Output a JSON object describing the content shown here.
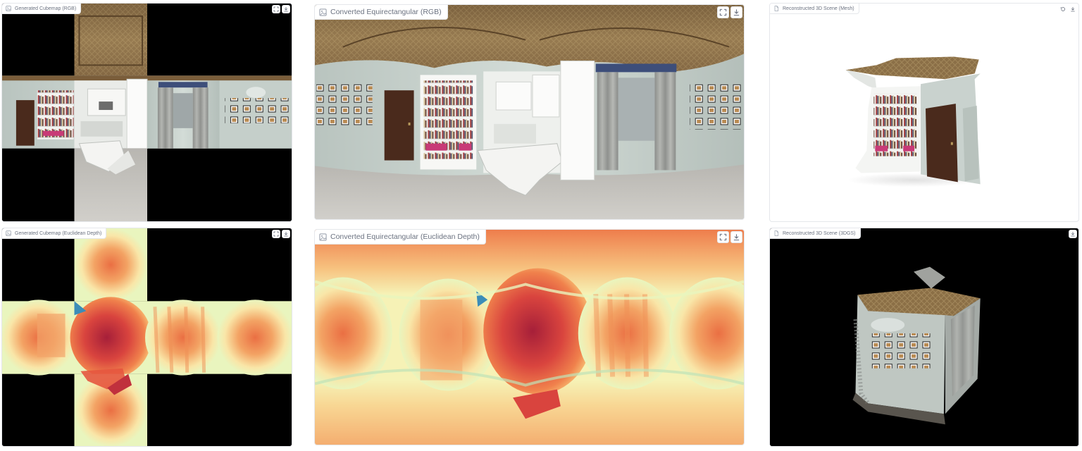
{
  "panels": {
    "cubemap_rgb": {
      "label": "Generated Cubemap (RGB)",
      "actions": [
        "fullscreen-icon",
        "download-icon"
      ]
    },
    "equirect_rgb": {
      "label": "Converted Equirectangular (RGB)",
      "actions": [
        "fullscreen-icon",
        "download-icon"
      ]
    },
    "mesh": {
      "label": "Reconstructed 3D Scene (Mesh)",
      "actions": [
        "reset-view-icon",
        "download-icon"
      ]
    },
    "cubemap_depth": {
      "label": "Generated Cubemap (Euclidean Depth)",
      "actions": [
        "fullscreen-icon",
        "download-icon"
      ]
    },
    "equirect_depth": {
      "label": "Converted Equirectangular (Euclidean Depth)",
      "actions": [
        "fullscreen-icon",
        "download-icon"
      ]
    },
    "gs3d": {
      "label": "Reconstructed 3D Scene (3DGS)",
      "actions": [
        "download-icon"
      ]
    }
  },
  "colors": {
    "wall": "#c9d3ce",
    "ceiling": "#8a6d45",
    "floor": "#c4c2bd",
    "door": "#4a2a1c",
    "depth_near": "#b2283c",
    "depth_mid": "#f08a4b",
    "depth_far": "#f7f5b8",
    "depth_edge": "#3c8db8"
  }
}
